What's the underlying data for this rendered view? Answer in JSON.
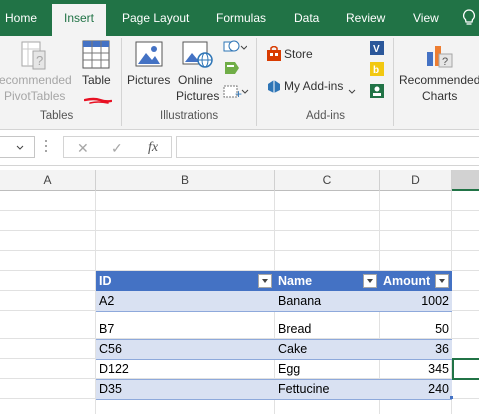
{
  "ribbon_tabs": [
    {
      "label": "Home"
    },
    {
      "label": "Insert"
    },
    {
      "label": "Page Layout"
    },
    {
      "label": "Formulas"
    },
    {
      "label": "Data"
    },
    {
      "label": "Review"
    },
    {
      "label": "View"
    }
  ],
  "active_tab": "Insert",
  "tell_me_icon": "lightbulb-icon",
  "groups": {
    "tables": {
      "label": "Tables",
      "recommended_pivot_line1": "ecommended",
      "recommended_pivot_line2": "PivotTables",
      "table_label": "Table"
    },
    "illustrations": {
      "label": "Illustrations",
      "pictures_label": "Pictures",
      "online_pictures_line1": "Online",
      "online_pictures_line2": "Pictures"
    },
    "addins": {
      "label": "Add-ins",
      "store_label": "Store",
      "my_addins_label": "My Add-ins"
    },
    "charts": {
      "recommended_charts_line1": "Recommended",
      "recommended_charts_line2": "Charts"
    }
  },
  "formula_bar": {
    "cancel_glyph": "✕",
    "enter_glyph": "✓",
    "fx_glyph": "fx",
    "value": ""
  },
  "columns": [
    {
      "label": "A"
    },
    {
      "label": "B"
    },
    {
      "label": "C"
    },
    {
      "label": "D"
    }
  ],
  "table": {
    "headers": [
      "ID",
      "Name",
      "Amount"
    ],
    "rows": [
      {
        "id": "A2",
        "name": "Banana",
        "amount": "1002"
      },
      {
        "id": "B7",
        "name": "Bread",
        "amount": "50"
      },
      {
        "id": "C56",
        "name": "Cake",
        "amount": "36"
      },
      {
        "id": "D122",
        "name": "Egg",
        "amount": "345"
      },
      {
        "id": "D35",
        "name": "Fettucine",
        "amount": "240"
      }
    ]
  },
  "colors": {
    "ribbon_green": "#217346",
    "table_header_blue": "#4472c4",
    "table_band": "#d9e1f2",
    "annotation_red": "#e81123"
  }
}
